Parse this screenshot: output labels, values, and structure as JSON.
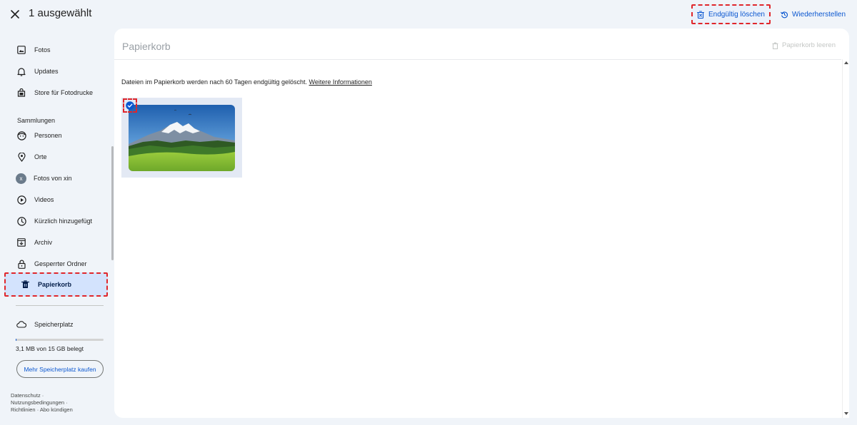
{
  "topbar": {
    "selection_title": "1 ausgewählt",
    "delete_label": "Endgültig löschen",
    "restore_label": "Wiederherstellen"
  },
  "sidebar": {
    "items": [
      {
        "label": "Fotos",
        "icon": "photo-icon"
      },
      {
        "label": "Updates",
        "icon": "bell-icon"
      },
      {
        "label": "Store für Fotodrucke",
        "icon": "store-icon"
      }
    ],
    "collections_heading": "Sammlungen",
    "collections": [
      {
        "label": "Personen",
        "icon": "face-icon"
      },
      {
        "label": "Orte",
        "icon": "location-pin-icon"
      },
      {
        "label": "Fotos von xin",
        "icon": "avatar-icon",
        "avatar_letter": "x"
      },
      {
        "label": "Videos",
        "icon": "play-circle-icon"
      },
      {
        "label": "Kürzlich hinzugefügt",
        "icon": "clock-icon"
      },
      {
        "label": "Archiv",
        "icon": "archive-icon"
      },
      {
        "label": "Gesperrter Ordner",
        "icon": "lock-icon"
      }
    ],
    "active": {
      "label": "Papierkorb",
      "icon": "trash-icon"
    },
    "storage": {
      "label": "Speicherplatz",
      "icon": "cloud-icon",
      "used_text": "3,1 MB von 15 GB belegt",
      "used_fraction": 0.002,
      "buy_label": "Mehr Speicherplatz kaufen"
    },
    "footer": {
      "privacy": "Datenschutz",
      "terms": "Nutzungsbedingungen",
      "policies": "Richtlinien",
      "cancel": "Abo kündigen",
      "separator": "·"
    }
  },
  "main": {
    "title": "Papierkorb",
    "empty_trash_label": "Papierkorb leeren",
    "info_text": "Dateien im Papierkorb werden nach 60 Tagen endgültig gelöscht.",
    "info_link": "Weitere Informationen"
  },
  "colors": {
    "accent": "#0b57d0",
    "active_bg": "#d3e3fd",
    "highlight_border": "#e0262b",
    "page_bg": "#f0f4f9"
  }
}
